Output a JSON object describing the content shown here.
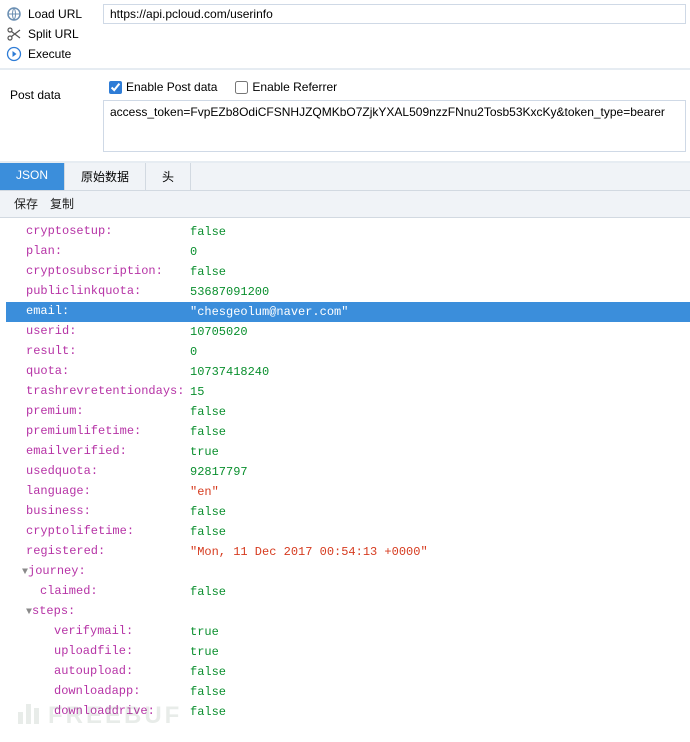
{
  "actions": {
    "load": "Load URL",
    "split": "Split URL",
    "execute": "Execute"
  },
  "url": "https://api.pcloud.com/userinfo",
  "post": {
    "label": "Post data",
    "enable_post": "Enable Post data",
    "enable_referrer": "Enable Referrer",
    "enable_post_checked": true,
    "enable_referrer_checked": false,
    "body": "access_token=FvpEZb8OdiCFSNHJZQMKbO7ZjkYXAL509nzzFNnu2Tosb53KxcKy&token_type=bearer"
  },
  "tabs": {
    "json": "JSON",
    "raw": "原始数据",
    "headers": "头"
  },
  "subtool": {
    "save": "保存",
    "copy": "复制"
  },
  "json": {
    "rows": [
      {
        "indent": 1,
        "twisty": "",
        "key": "cryptosetup",
        "val": "false",
        "type": "false"
      },
      {
        "indent": 1,
        "twisty": "",
        "key": "plan",
        "val": "0",
        "type": "number"
      },
      {
        "indent": 1,
        "twisty": "",
        "key": "cryptosubscription",
        "val": "false",
        "type": "false"
      },
      {
        "indent": 1,
        "twisty": "",
        "key": "publiclinkquota",
        "val": "53687091200",
        "type": "number"
      },
      {
        "indent": 1,
        "twisty": "",
        "key": "email",
        "val": "\"chesgeolum@naver.com\"",
        "type": "string",
        "highlight": true
      },
      {
        "indent": 1,
        "twisty": "",
        "key": "userid",
        "val": "10705020",
        "type": "number"
      },
      {
        "indent": 1,
        "twisty": "",
        "key": "result",
        "val": "0",
        "type": "number"
      },
      {
        "indent": 1,
        "twisty": "",
        "key": "quota",
        "val": "10737418240",
        "type": "number"
      },
      {
        "indent": 1,
        "twisty": "",
        "key": "trashrevretentiondays",
        "val": "15",
        "type": "number"
      },
      {
        "indent": 1,
        "twisty": "",
        "key": "premium",
        "val": "false",
        "type": "false"
      },
      {
        "indent": 1,
        "twisty": "",
        "key": "premiumlifetime",
        "val": "false",
        "type": "false"
      },
      {
        "indent": 1,
        "twisty": "",
        "key": "emailverified",
        "val": "true",
        "type": "true"
      },
      {
        "indent": 1,
        "twisty": "",
        "key": "usedquota",
        "val": "92817797",
        "type": "number"
      },
      {
        "indent": 1,
        "twisty": "",
        "key": "language",
        "val": "\"en\"",
        "type": "string"
      },
      {
        "indent": 1,
        "twisty": "",
        "key": "business",
        "val": "false",
        "type": "false"
      },
      {
        "indent": 1,
        "twisty": "",
        "key": "cryptolifetime",
        "val": "false",
        "type": "false"
      },
      {
        "indent": 1,
        "twisty": "",
        "key": "registered",
        "val": "\"Mon, 11 Dec 2017 00:54:13 +0000\"",
        "type": "string"
      },
      {
        "indent": 0,
        "twisty": "▼",
        "key": "journey",
        "val": "",
        "type": "obj"
      },
      {
        "indent": 2,
        "twisty": "",
        "key": "claimed",
        "val": "false",
        "type": "false"
      },
      {
        "indent": 1,
        "twisty": "▼",
        "key": "steps",
        "val": "",
        "type": "obj"
      },
      {
        "indent": 3,
        "twisty": "",
        "key": "verifymail",
        "val": "true",
        "type": "true"
      },
      {
        "indent": 3,
        "twisty": "",
        "key": "uploadfile",
        "val": "true",
        "type": "true"
      },
      {
        "indent": 3,
        "twisty": "",
        "key": "autoupload",
        "val": "false",
        "type": "false"
      },
      {
        "indent": 3,
        "twisty": "",
        "key": "downloadapp",
        "val": "false",
        "type": "false"
      },
      {
        "indent": 3,
        "twisty": "",
        "key": "downloaddrive",
        "val": "false",
        "type": "false"
      }
    ]
  },
  "watermark": "FREEBUF"
}
